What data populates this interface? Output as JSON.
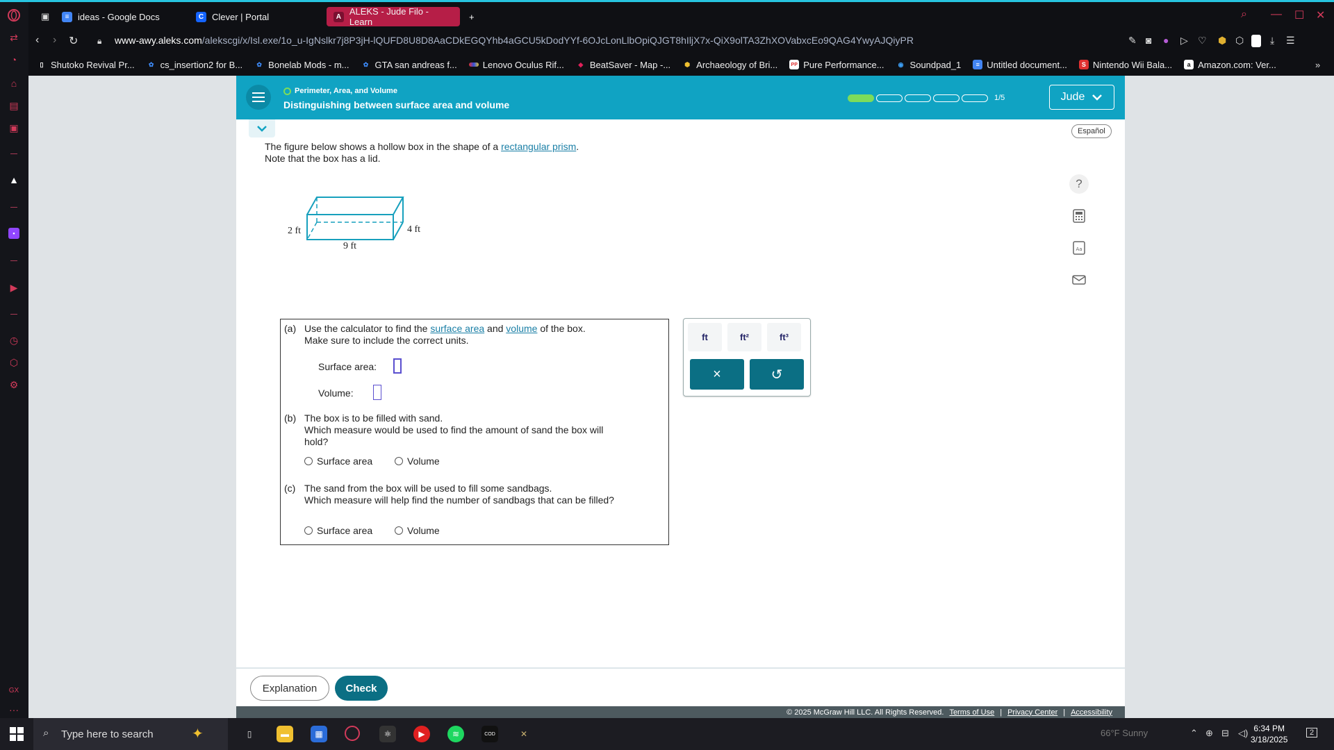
{
  "browser": {
    "tabs": [
      {
        "label": "ideas - Google Docs",
        "icon": "docs-icon",
        "color": "#4285f4",
        "active": false
      },
      {
        "label": "Clever | Portal",
        "icon": "clever-icon",
        "color": "#1464ff",
        "active": false
      },
      {
        "label": "ALEKS - Jude Filo - Learn",
        "icon": "aleks-icon",
        "color": "#b61e47",
        "active": true
      }
    ],
    "new_tab_symbol": "+",
    "url_host": "www-awy.aleks.com",
    "url_path": "/alekscgi/x/Isl.exe/1o_u-IgNslkr7j8P3jH-lQUFD8U8D8AaCDkEGQYhb4aGCU5kDodYYf-6OJcLonLlbOpiQJGT8hIljX7x-QiX9olTA3ZhXOVabxcEo9QAG4YwyAJQiyPR",
    "bookmarks": [
      {
        "label": "Shutoko Revival Pr...",
        "color": "#ffffff"
      },
      {
        "label": "cs_insertion2 for B...",
        "color": "#3d8af7"
      },
      {
        "label": "Bonelab Mods - m...",
        "color": "#3d8af7"
      },
      {
        "label": "GTA san andreas f...",
        "color": "#3d8af7"
      },
      {
        "label": "Lenovo Oculus Rif...",
        "color": "#e03030"
      },
      {
        "label": "BeatSaver - Map -...",
        "color": "#e0205a"
      },
      {
        "label": "Archaeology of Bri...",
        "color": "#f0c030"
      },
      {
        "label": "Pure Performance...",
        "color": "#e03030"
      },
      {
        "label": "Soundpad_1",
        "color": "#3da0f7"
      },
      {
        "label": "Untitled document...",
        "color": "#4285f4"
      },
      {
        "label": "Nintendo Wii Bala...",
        "color": "#e03030"
      },
      {
        "label": "Amazon.com: Ver...",
        "color": "#ffffff"
      }
    ]
  },
  "header": {
    "topic": "Perimeter, Area, and Volume",
    "lesson": "Distinguishing between surface area and volume",
    "progress_filled": 1,
    "progress_total": 5,
    "progress_label": "1/5",
    "user": "Jude",
    "language_button": "Español"
  },
  "problem": {
    "line1_pre": "The figure below shows a hollow box in the shape of a ",
    "line1_link": "rectangular prism",
    "line1_post": ".",
    "line2": "Note that the box has a lid.",
    "figure": {
      "height_label": "2 ft",
      "depth_label": "4 ft",
      "length_label": "9 ft"
    }
  },
  "questions": {
    "a_tag": "(a)",
    "a_pre": "Use the calculator to find the ",
    "a_link1": "surface area",
    "a_mid": " and ",
    "a_link2": "volume",
    "a_post": " of the box.",
    "a_line2": "Make sure to include the correct units.",
    "surface_label": "Surface area:",
    "volume_label": "Volume:",
    "b_tag": "(b)",
    "b_line1": "The box is to be filled with sand.",
    "b_line2": "Which measure would be used to find the amount of sand the box will",
    "b_line3": "hold?",
    "c_tag": "(c)",
    "c_line1": "The sand from the box will be used to fill some sandbags.",
    "c_line2": "Which measure will help find the number of sandbags that can be filled?",
    "option_surface": "Surface area",
    "option_volume": "Volume"
  },
  "palette": {
    "units": [
      "ft",
      "ft²",
      "ft³"
    ],
    "clear_symbol": "×",
    "undo_symbol": "↺"
  },
  "footer": {
    "explanation": "Explanation",
    "check": "Check",
    "copyright": "© 2025 McGraw Hill LLC. All Rights Reserved.",
    "terms": "Terms of Use",
    "privacy": "Privacy Center",
    "accessibility": "Accessibility",
    "separator": "|"
  },
  "taskbar": {
    "search_placeholder": "Type here to search",
    "weather": "66°F  Sunny",
    "time": "6:34 PM",
    "date": "3/18/2025",
    "notifications": "2"
  },
  "sidebar": {
    "gx_label": "GX",
    "more": "···"
  },
  "colors": {
    "aleks_teal": "#10a3c3",
    "button_dark_teal": "#0b6f84",
    "progress_green": "#7ddc5a",
    "opera_red": "#b61e47"
  }
}
